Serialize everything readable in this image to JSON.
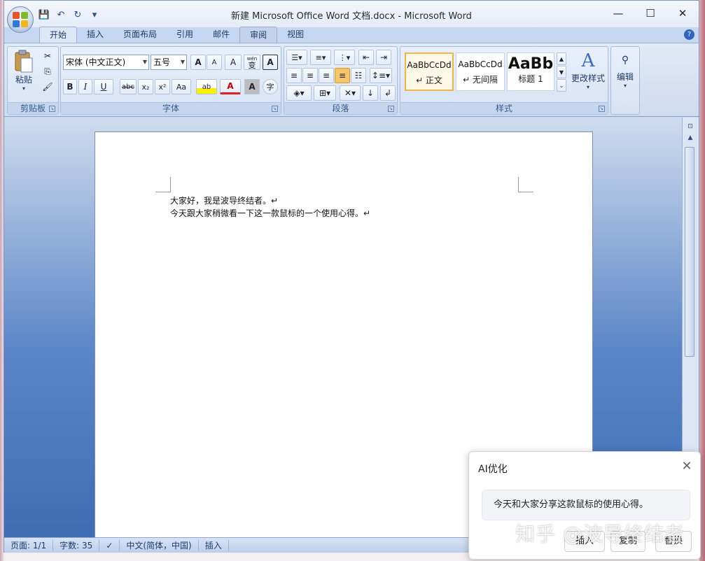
{
  "app": {
    "title": "新建 Microsoft Office Word 文档.docx - Microsoft Word",
    "window_controls": {
      "minimize": "—",
      "maximize": "☐",
      "close": "✕"
    },
    "help": "?"
  },
  "qat": {
    "save_icon": "💾",
    "undo_icon": "↶",
    "redo_icon": "↻",
    "customize_icon": "▾"
  },
  "tabs": [
    {
      "label": "开始"
    },
    {
      "label": "插入"
    },
    {
      "label": "页面布局"
    },
    {
      "label": "引用"
    },
    {
      "label": "邮件"
    },
    {
      "label": "审阅"
    },
    {
      "label": "视图"
    }
  ],
  "ribbon": {
    "clipboard": {
      "label": "剪贴板",
      "paste": "粘贴"
    },
    "font": {
      "label": "字体",
      "font_name": "宋体 (中文正文)",
      "font_size": "五号",
      "grow": "A",
      "shrink": "A",
      "clear": "A",
      "phonetic": "wén",
      "phonetic_char": "变",
      "border_char": "A",
      "bold": "B",
      "italic": "I",
      "underline": "U",
      "strike": "abc",
      "subscript": "x₂",
      "superscript": "x²",
      "case": "Aa",
      "highlight": "ab",
      "font_color": "A",
      "shading": "A",
      "enclose": "字"
    },
    "paragraph": {
      "label": "段落"
    },
    "styles": {
      "label": "样式",
      "items": [
        {
          "sample": "AaBbCcDd",
          "name": "↵ 正文"
        },
        {
          "sample": "AaBbCcDd",
          "name": "↵ 无间隔"
        },
        {
          "sample": "AaBb",
          "name": "标题 1"
        }
      ],
      "change_styles": "更改样式"
    },
    "editing": {
      "label": "编辑"
    }
  },
  "document": {
    "lines": [
      "大家好，我是波导终结者。↵",
      "今天跟大家稍微看一下这一款鼠标的一个使用心得。↵"
    ]
  },
  "status": {
    "page": "页面: 1/1",
    "words": "字数: 35",
    "language": "中文(简体，中国)",
    "mode": "插入"
  },
  "ai_popup": {
    "title": "AI优化",
    "suggestion": "今天和大家分享这款鼠标的使用心得。",
    "insert": "插入",
    "copy": "复制",
    "replace": "替换"
  },
  "watermark": "知乎 @波导终结者"
}
